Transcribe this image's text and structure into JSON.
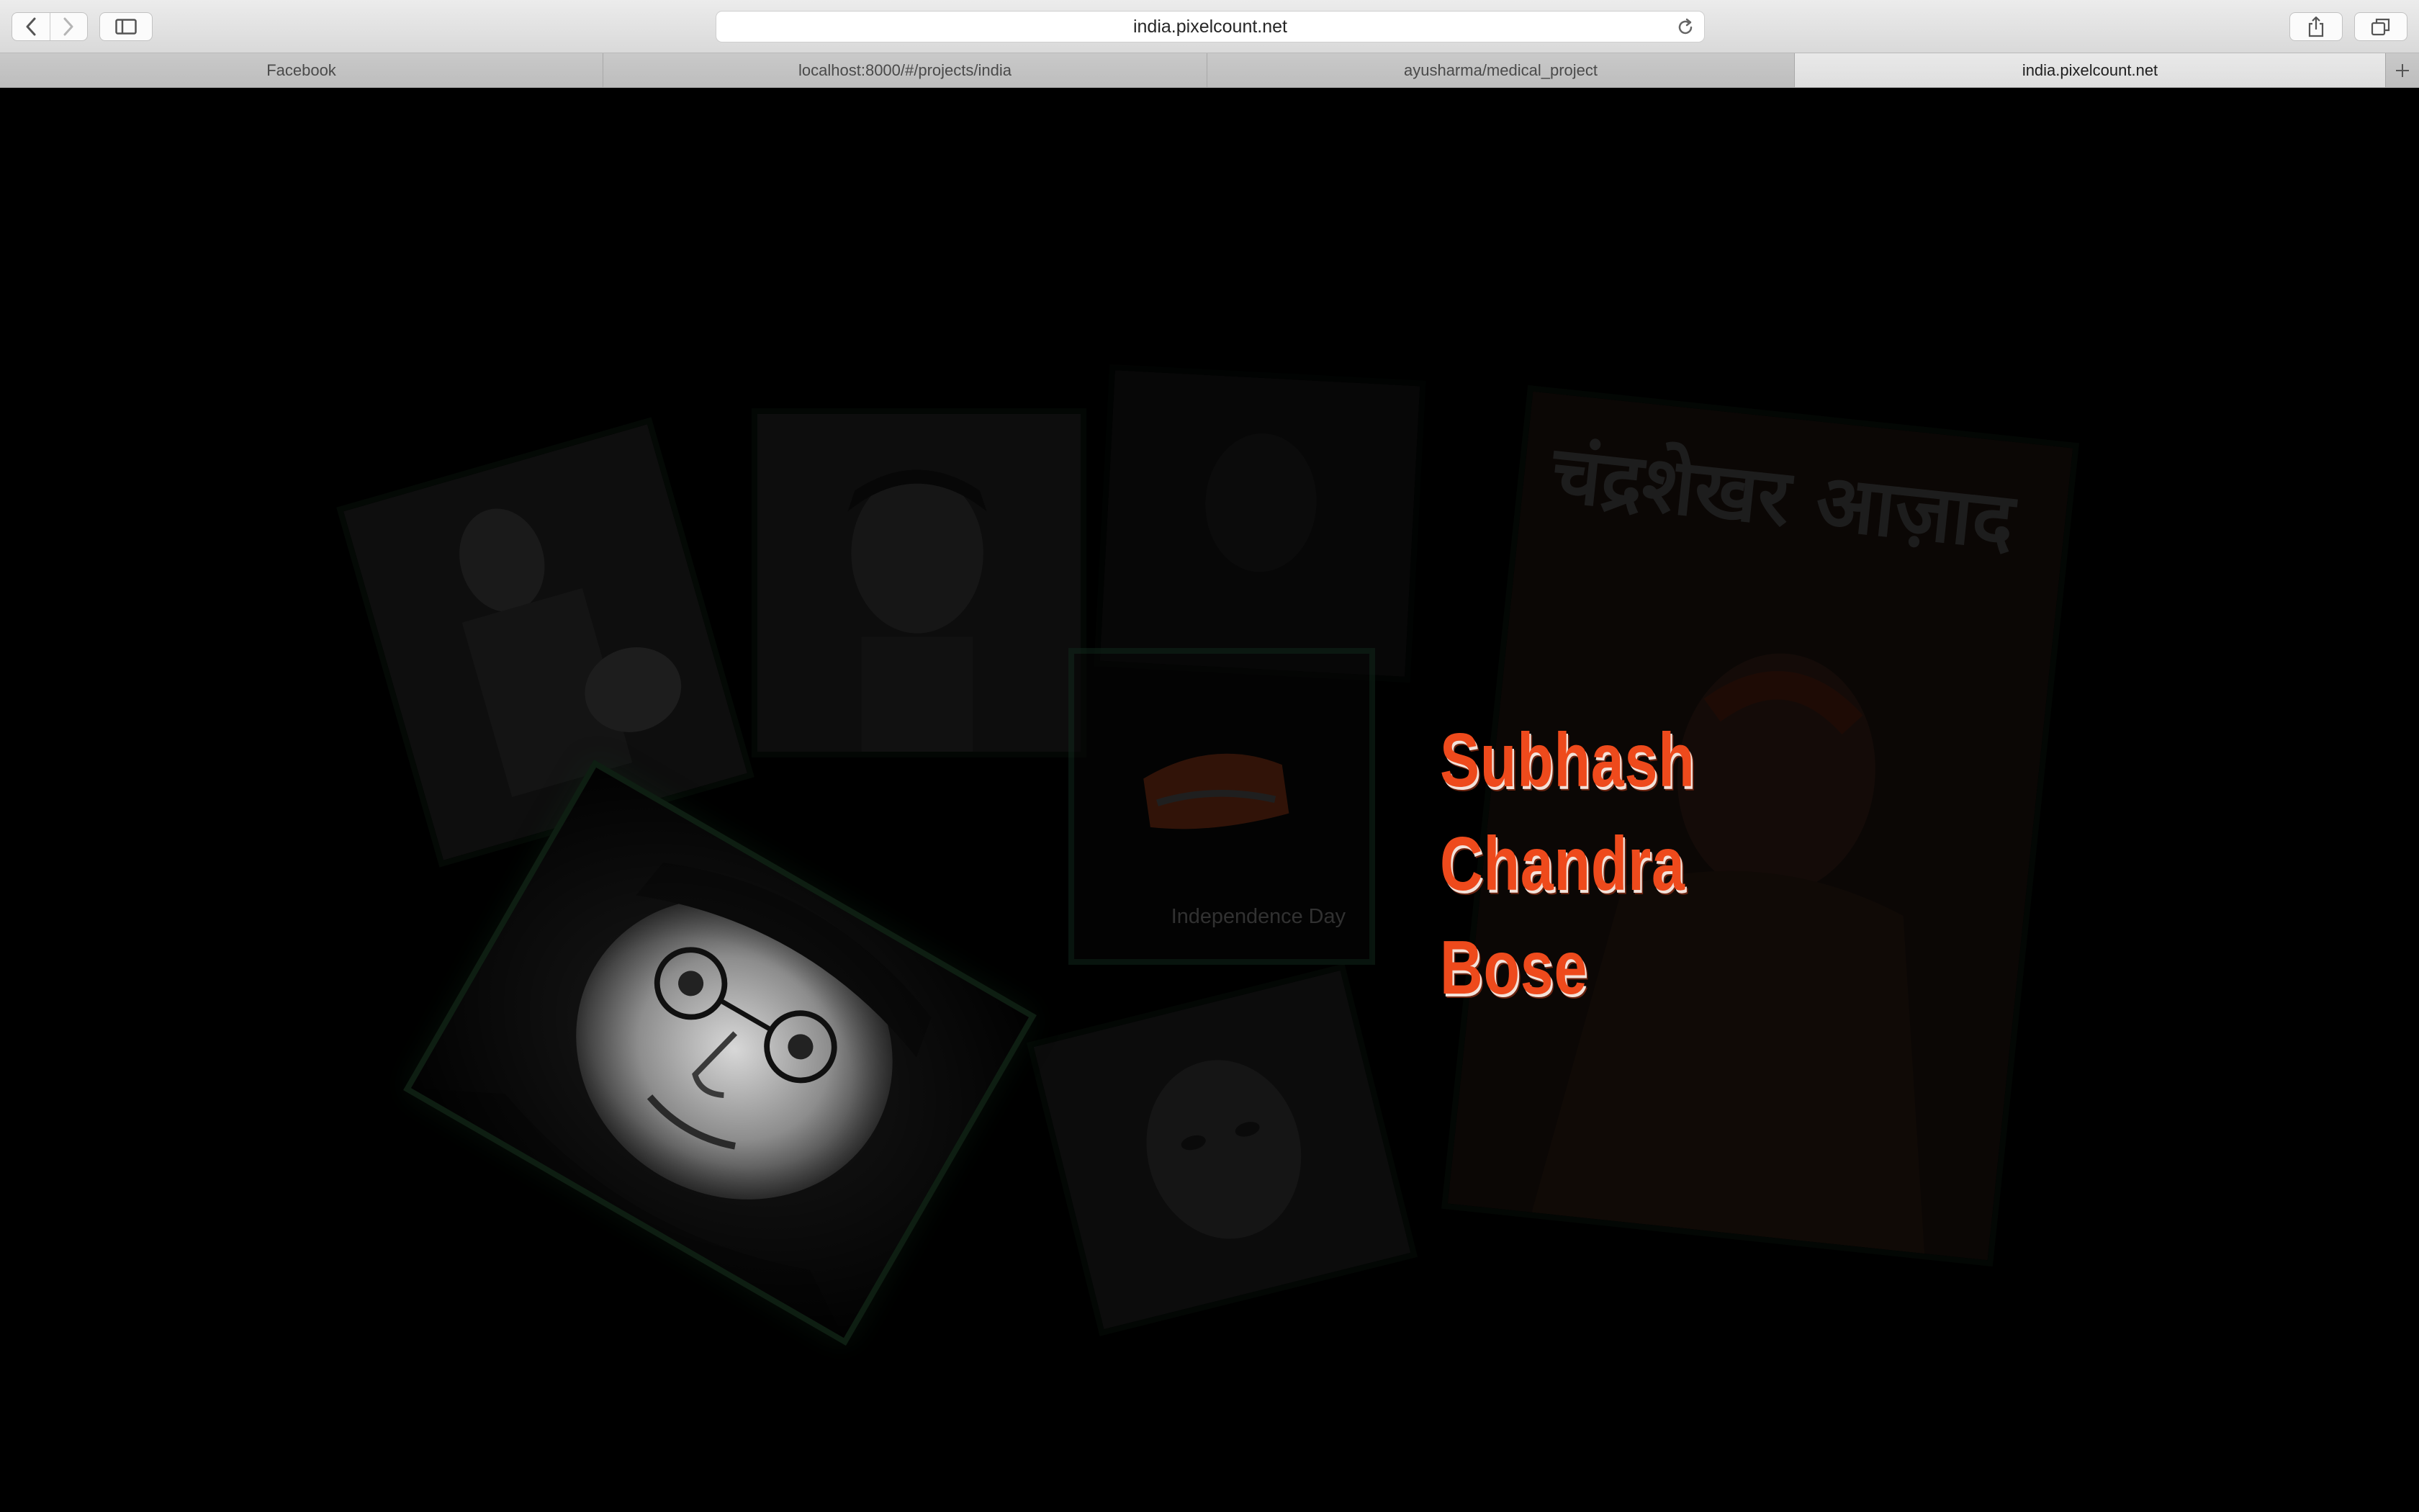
{
  "browser": {
    "url": "india.pixelcount.net",
    "tabs": [
      {
        "label": "Facebook",
        "active": false
      },
      {
        "label": "localhost:8000/#/projects/india",
        "active": false
      },
      {
        "label": "ayusharma/medical_project",
        "active": false
      },
      {
        "label": "india.pixelcount.net",
        "active": true
      }
    ],
    "icons": {
      "back": "chevron-left-icon",
      "forward": "chevron-right-icon",
      "sidebar": "sidebar-icon",
      "reload": "reload-icon",
      "share": "share-icon",
      "tabs": "tabs-overview-icon",
      "new_tab": "plus-icon"
    }
  },
  "content": {
    "name_lines": [
      "Subhash",
      "Chandra",
      "Bose"
    ],
    "poster_text": "चंद्रशेखर आज़ाद",
    "card_caption": "Independence Day",
    "colors": {
      "name": "#ee4a1c",
      "frame": "#0d1a10",
      "background": "#000000"
    }
  }
}
